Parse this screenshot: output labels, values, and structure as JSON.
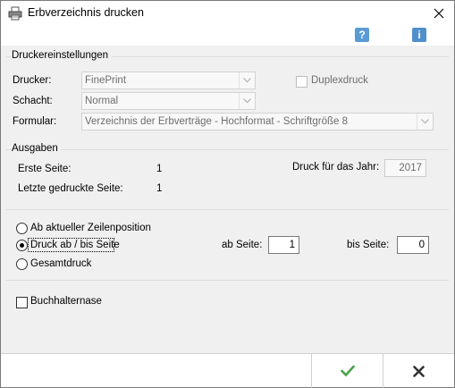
{
  "window": {
    "title": "Erbverzeichnis drucken"
  },
  "druckereinstellungen": {
    "group_label": "Druckereinstellungen",
    "drucker_label": "Drucker:",
    "drucker_value": "FinePrint",
    "schacht_label": "Schacht:",
    "schacht_value": "Normal",
    "formular_label": "Formular:",
    "formular_value": "Verzeichnis der Erbverträge - Hochformat - Schriftgröße 8",
    "duplex_label": "Duplexdruck",
    "duplex_checked": false
  },
  "ausgaben": {
    "group_label": "Ausgaben",
    "erste_seite_label": "Erste Seite:",
    "erste_seite_value": "1",
    "letzte_seite_label": "Letzte gedruckte Seite:",
    "letzte_seite_value": "1",
    "jahr_label": "Druck für das Jahr:",
    "jahr_value": "2017",
    "option_zeilenposition": "Ab aktueller Zeilenposition",
    "option_seite": "Druck ab / bis Seite",
    "option_gesamt": "Gesamtdruck",
    "selected_option": "Druck ab / bis Seite",
    "ab_seite_label": "ab Seite:",
    "ab_seite_value": "1",
    "bis_seite_label": "bis Seite:",
    "bis_seite_value": "0",
    "buchhalternase_label": "Buchhalternase",
    "buchhalternase_checked": false
  },
  "icons": {
    "title": "printer-icon",
    "close": "close-icon",
    "help": "help-icon",
    "info": "info-icon",
    "ok": "checkmark-icon",
    "cancel": "cross-icon"
  },
  "colors": {
    "help_icon": "#5a9bd5",
    "info_icon": "#4f8fcc",
    "checkmark": "#4aa14a"
  }
}
